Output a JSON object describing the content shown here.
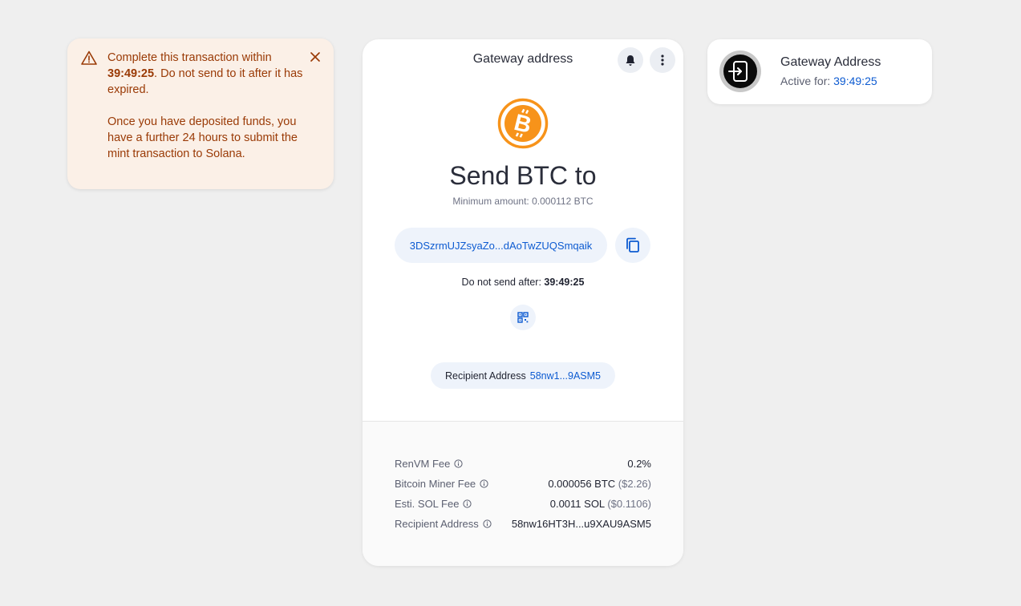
{
  "warning": {
    "line1_prefix": "Complete this transaction within",
    "time": "39:49:25",
    "line1_suffix": ". Do not send to it after it has expired.",
    "line2": "Once you have deposited funds, you have a further 24 hours to submit the mint transaction to Solana.",
    "icon": "warning-triangle-icon",
    "close_icon": "close-icon"
  },
  "gateway_card": {
    "title": "Gateway address",
    "heading": "Send BTC to",
    "minimum_amount": "Minimum amount: 0.000112 BTC",
    "address": "3DSzrmUJZsyaZo...dAoTwZUQSmqaik",
    "not_after_label": "Do not send after:",
    "not_after_time": "39:49:25",
    "recipient_label": "Recipient Address",
    "recipient_value": "58nw1...9ASM5",
    "fees": [
      {
        "label": "RenVM Fee",
        "value": "0.2%",
        "usd": ""
      },
      {
        "label": "Bitcoin Miner Fee",
        "value": "0.000056 BTC",
        "usd": "($2.26)"
      },
      {
        "label": "Esti. SOL Fee",
        "value": "0.0011 SOL",
        "usd": "($0.1106)"
      },
      {
        "label": "Recipient Address",
        "value": "58nw16HT3H...u9XAU9ASM5",
        "usd": ""
      }
    ]
  },
  "side_card": {
    "title": "Gateway Address",
    "active_label": "Active for:",
    "active_time": "39:49:25"
  },
  "colors": {
    "accent": "#0d5bd1",
    "btc_orange": "#f7931a",
    "warning_text": "#9a3a06",
    "warning_bg": "#fbf0e7"
  }
}
